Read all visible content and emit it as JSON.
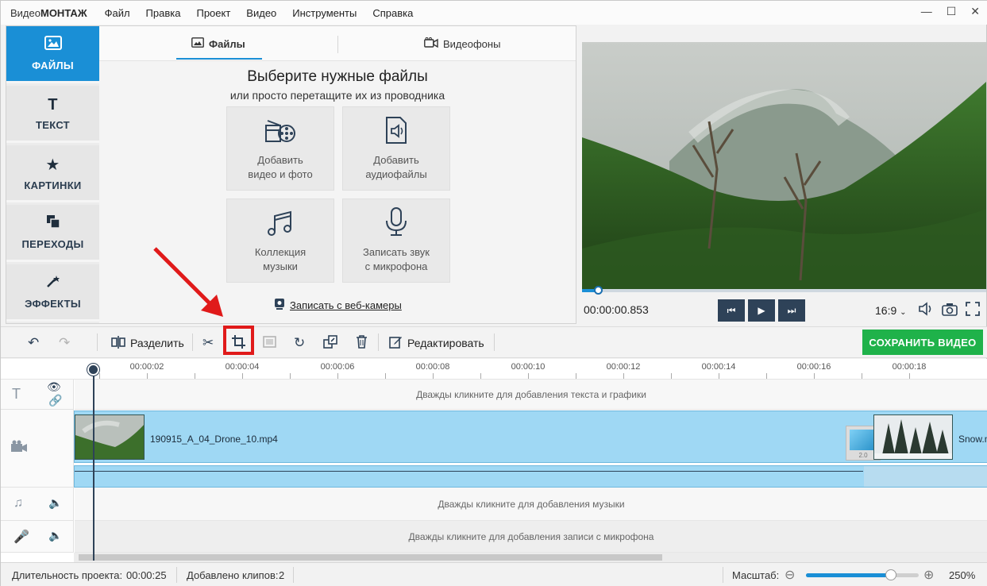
{
  "app": {
    "logo_plain": "Видео",
    "logo_bold": "МОНТАЖ"
  },
  "menu": [
    "Файл",
    "Правка",
    "Проект",
    "Видео",
    "Инструменты",
    "Справка"
  ],
  "window_controls": [
    "minimize",
    "maximize",
    "close"
  ],
  "sidebar": [
    {
      "label": "ФАЙЛЫ",
      "icon": "image-icon",
      "active": true
    },
    {
      "label": "ТЕКСТ",
      "icon": "text-icon",
      "active": false
    },
    {
      "label": "КАРТИНКИ",
      "icon": "star-icon",
      "active": false
    },
    {
      "label": "ПЕРЕХОДЫ",
      "icon": "transitions-icon",
      "active": false
    },
    {
      "label": "ЭФФЕКТЫ",
      "icon": "magic-wand-icon",
      "active": false
    }
  ],
  "tabs": [
    {
      "label": "Файлы",
      "active": true
    },
    {
      "label": "Видеофоны",
      "active": false
    }
  ],
  "files_panel": {
    "heading": "Выберите нужные файлы",
    "subheading": "или просто перетащите их из проводника",
    "tiles": [
      {
        "line1": "Добавить",
        "line2": "видео и фото",
        "icon": "film-reel-icon"
      },
      {
        "line1": "Добавить",
        "line2": "аудиофайлы",
        "icon": "audio-file-icon"
      },
      {
        "line1": "Коллекция",
        "line2": "музыки",
        "icon": "music-notes-icon"
      },
      {
        "line1": "Записать звук",
        "line2": "с микрофона",
        "icon": "microphone-icon"
      }
    ],
    "webcam_label": "Записать с веб-камеры"
  },
  "preview": {
    "timecode": "00:00:00.853",
    "aspect": "16:9",
    "progress": 0.04
  },
  "toolbar": {
    "split_label": "Разделить",
    "edit_label": "Редактировать",
    "save_label": "СОХРАНИТЬ ВИДЕО"
  },
  "ruler": [
    "00:00:02",
    "00:00:04",
    "00:00:06",
    "00:00:08",
    "00:00:10",
    "00:00:12",
    "00:00:14",
    "00:00:16",
    "00:00:18"
  ],
  "timeline": {
    "text_hint": "Дважды кликните для добавления текста и графики",
    "clip1_name": "190915_A_04_Drone_10.mp4",
    "clip2_name": "Snow.m",
    "transition_duration": "2.0",
    "music_hint": "Дважды кликните для добавления музыки",
    "mic_hint": "Дважды кликните для добавления записи с микрофона"
  },
  "status": {
    "duration_label": "Длительность проекта:",
    "duration_value": "00:00:25",
    "clips_label": "Добавлено клипов:",
    "clips_value": "2",
    "zoom_label": "Масштаб:",
    "zoom_value": "250%",
    "zoom_level": 0.75
  },
  "colors": {
    "accent": "#1a8fd6",
    "save_button": "#1fb24a",
    "highlight": "#e01a1a",
    "dark_button": "#2e4258"
  }
}
